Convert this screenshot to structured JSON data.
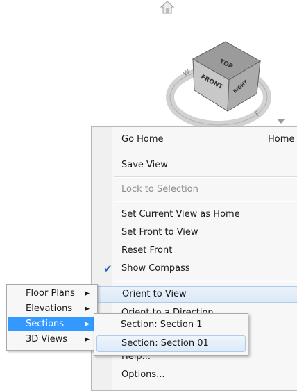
{
  "viewcube": {
    "top_label": "TOP",
    "front_label": "FRONT",
    "right_label": "RIGHT"
  },
  "menu": {
    "items": [
      {
        "label": "Go Home",
        "shortcut": "Home"
      },
      {
        "label": "Save View"
      },
      {
        "label": "Lock to Selection",
        "disabled": true
      },
      {
        "label": "Set Current View as Home"
      },
      {
        "label": "Set Front to View"
      },
      {
        "label": "Reset Front"
      },
      {
        "label": "Show Compass",
        "checked": true
      },
      {
        "label": "Orient to View",
        "highlighted": true
      },
      {
        "label": "Orient to a Direction"
      },
      {
        "label": "Help..."
      },
      {
        "label": "Options..."
      }
    ]
  },
  "view_submenu": {
    "items": [
      {
        "label": "Floor Plans"
      },
      {
        "label": "Elevations"
      },
      {
        "label": "Sections",
        "selected": true
      },
      {
        "label": "3D Views"
      }
    ]
  },
  "sections_submenu": {
    "items": [
      {
        "label": "Section: Section 1"
      },
      {
        "label": "Section: Section 01",
        "highlighted": true
      }
    ]
  },
  "colors": {
    "selection": "#3399ff",
    "hover_border": "#aecbeb",
    "checkmark": "#2561b4"
  }
}
